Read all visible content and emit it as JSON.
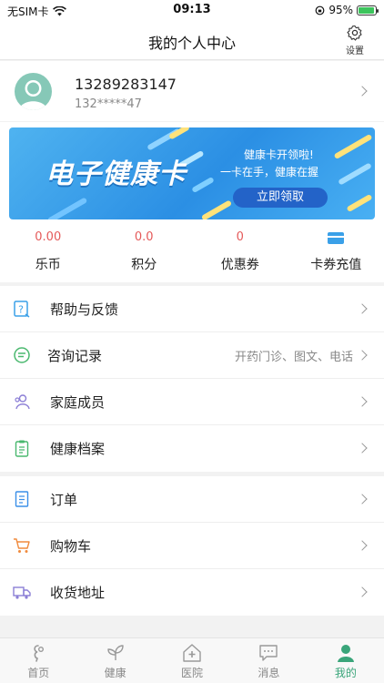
{
  "status_bar": {
    "carrier": "无SIM卡",
    "time": "09:13",
    "battery": "95%",
    "battery_level": 0.95
  },
  "header": {
    "title": "我的个人中心",
    "settings_label": "设置"
  },
  "profile": {
    "phone": "13289283147",
    "masked_phone": "132*****47"
  },
  "banner": {
    "title": "电子健康卡",
    "line1": "健康卡开领啦!",
    "line2": "一卡在手，健康在握",
    "button": "立即领取"
  },
  "stats": [
    {
      "value": "0.00",
      "label": "乐币"
    },
    {
      "value": "0.0",
      "label": "积分"
    },
    {
      "value": "0",
      "label": "优惠券"
    },
    {
      "value": "",
      "label": "卡券充值",
      "icon": "card-icon"
    }
  ],
  "menu_group_1": [
    {
      "label": "帮助与反馈",
      "icon": "help-icon",
      "extra": ""
    },
    {
      "label": "咨询记录",
      "icon": "chat-icon",
      "extra": "开药门诊、图文、电话"
    },
    {
      "label": "家庭成员",
      "icon": "family-icon",
      "extra": ""
    },
    {
      "label": "健康档案",
      "icon": "clipboard-icon",
      "extra": ""
    }
  ],
  "menu_group_2": [
    {
      "label": "订单",
      "icon": "order-icon",
      "extra": ""
    },
    {
      "label": "购物车",
      "icon": "cart-icon",
      "extra": ""
    },
    {
      "label": "收货地址",
      "icon": "truck-icon",
      "extra": ""
    }
  ],
  "tabbar": [
    {
      "label": "首页",
      "icon": "home-icon"
    },
    {
      "label": "健康",
      "icon": "leaf-icon"
    },
    {
      "label": "医院",
      "icon": "hospital-icon"
    },
    {
      "label": "消息",
      "icon": "message-icon"
    },
    {
      "label": "我的",
      "icon": "person-icon",
      "active": true
    }
  ],
  "colors": {
    "accent": "#3aa57a",
    "stat_value": "#e55a5a",
    "banner": "#2b8fe4"
  }
}
